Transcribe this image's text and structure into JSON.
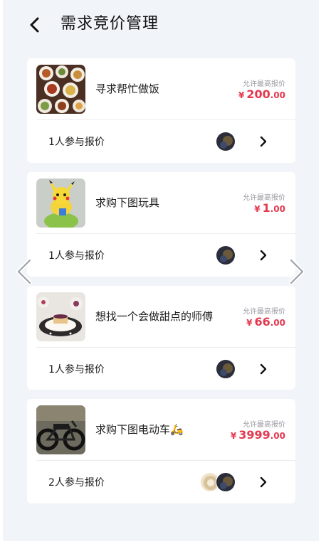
{
  "header": {
    "title": "需求竞价管理"
  },
  "icons": {
    "back": "chevron-left-icon",
    "row_arrow": "chevron-right-icon",
    "pager_prev": "pager-prev-icon",
    "pager_next": "pager-next-icon"
  },
  "colors": {
    "price": "#e3394f",
    "background": "#f1f4f9"
  },
  "cards": [
    {
      "title": "寻求帮忙做饭",
      "price_label": "允许最高报价",
      "currency": "¥",
      "price_int": "200",
      "price_dec": ".00",
      "bid_count": "1人参与报价",
      "image": "home-cooked-dishes"
    },
    {
      "title": "求购下图玩具",
      "price_label": "允许最高报价",
      "currency": "¥",
      "price_int": "1",
      "price_dec": ".00",
      "bid_count": "1人参与报价",
      "image": "pikachu-toy"
    },
    {
      "title": "想找一个会做甜点的师傅",
      "price_label": "允许最高报价",
      "currency": "¥",
      "price_int": "66",
      "price_dec": ".00",
      "bid_count": "1人参与报价",
      "image": "dessert-plates"
    },
    {
      "title": "求购下图电动车🛵",
      "price_label": "允许最高报价",
      "currency": "¥",
      "price_int": "3999",
      "price_dec": ".00",
      "bid_count": "2人参与报价",
      "image": "electric-bike"
    }
  ]
}
